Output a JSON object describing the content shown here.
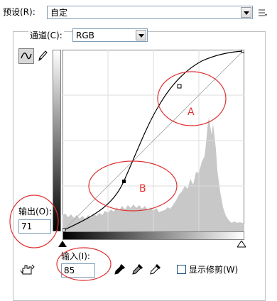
{
  "preset": {
    "label": "预设(R):",
    "value": "自定"
  },
  "channel": {
    "label": "通道(C):",
    "value": "RGB"
  },
  "output": {
    "label": "输出(O):",
    "value": "71"
  },
  "input": {
    "label": "输入(I):",
    "value": "85"
  },
  "clipping": {
    "label": "显示修剪(W)",
    "checked": false
  },
  "annotations": {
    "a": "A",
    "b": "B"
  },
  "colors": {
    "accent_red": "#e03030",
    "histogram": "#c8c8c8",
    "panel": "#ffffff"
  },
  "icons": [
    "menu-icon",
    "curve-tool-icon",
    "pencil-tool-icon",
    "hand-adjust-icon",
    "black-eyedropper-icon",
    "gray-eyedropper-icon",
    "white-eyedropper-icon"
  ]
}
